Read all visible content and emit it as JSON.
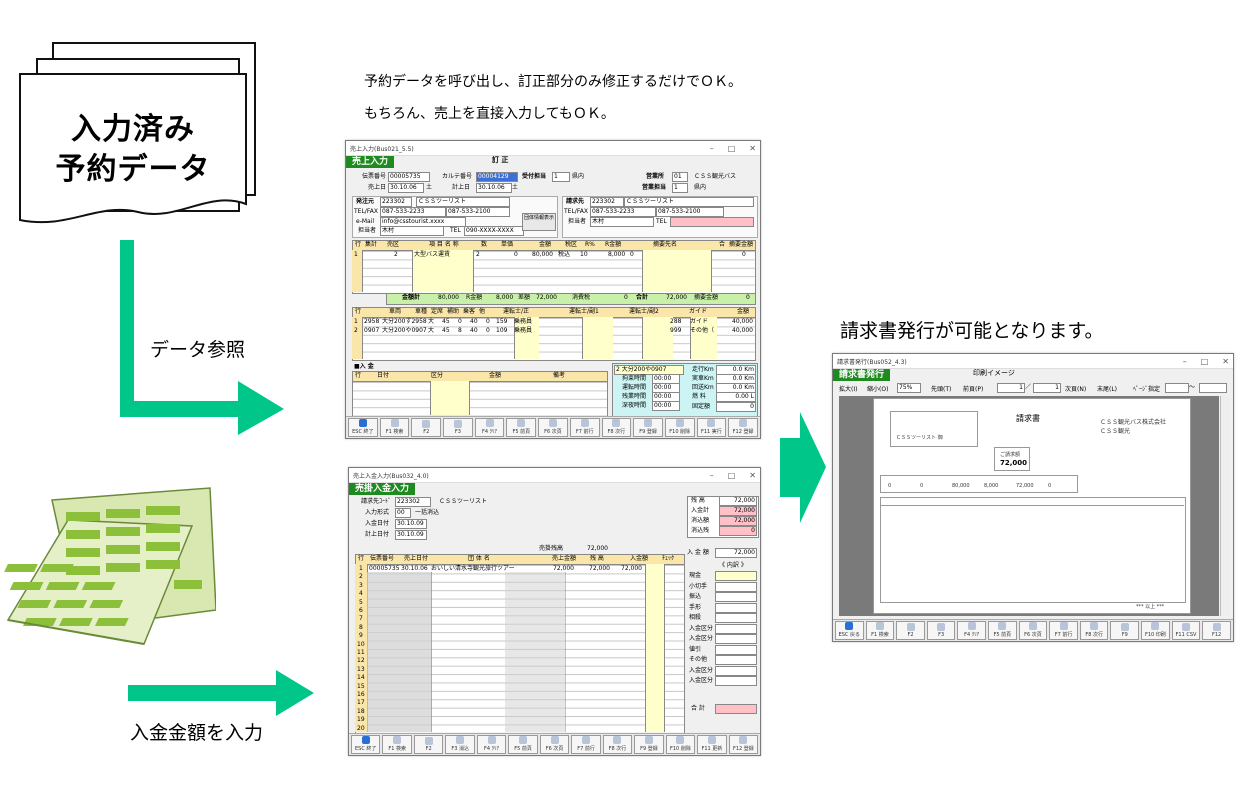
{
  "stack": {
    "line1": "入力済み",
    "line2": "予約データ"
  },
  "captions": {
    "top1": "予約データを呼び出し、訂正部分のみ修正するだけでＯＫ。",
    "top2": "もちろん、売上を直接入力してもＯＫ。",
    "ref": "データ参照",
    "invoice": "請求書発行が可能となります。",
    "payment": "入金金額を入力"
  },
  "colors": {
    "arrow": "#00c689",
    "titlebar": "#1f8a1f",
    "field_yellow": "#ffffcc",
    "field_pink": "#ffc0c8"
  },
  "sales_win": {
    "title": "売上入力(Bus021_5.5)",
    "header": "売上入力",
    "mode": "訂 正",
    "reserve_no_label": "伝票番号",
    "reserve_no": "00005735",
    "karte_label": "カルテ番号",
    "karte": "00004129",
    "charge_label": "受付担当",
    "charge": "1",
    "sales_date_label": "売上日",
    "sales_date": "30.10.06",
    "sales_dow": "土",
    "calc_date_label": "計上日",
    "calc_date": "30.10.06",
    "calc_dow": "土",
    "office_label": "営業所",
    "office": "01",
    "office_name": "ＣＳＳ観光バス",
    "sales_charge_label": "営業担当",
    "sales_charge": "1",
    "sales_charge_area": "県内",
    "orderer_label": "発注元",
    "orderer_code": "223302",
    "orderer_name": "ＣＳＳツーリスト",
    "tel_fax_label": "TEL/FAX",
    "tel": "087-533-2233",
    "fax": "087-533-2100",
    "email_label": "e-Mail",
    "email": "info@csstourist.xxxx",
    "person_label": "担当者",
    "person": "木村",
    "person_tel_label": "TEL",
    "person_tel": "090-XXXX-XXXX",
    "group_btn": "団体情報表示",
    "billto_label": "請求先",
    "billto_code": "223302",
    "billto_name": "ＣＳＳツーリスト",
    "billto_tel": "087-533-2233",
    "billto_fax": "087-533-2100",
    "billto_person": "木村",
    "cols1": [
      "行",
      "集計",
      "売区",
      "項 目 名 称",
      "数",
      "単価",
      "金額",
      "税区",
      "R%",
      "R金額",
      "摘要先名",
      "合",
      "摘要金額"
    ],
    "row1": {
      "no": "1",
      "item_code": "2",
      "item": "大型バス運賃",
      "qty": "2",
      "price": "0",
      "amount": "80,000",
      "tax": "税込",
      "r_pct": "10",
      "r_amount": "8,000",
      "mark": "0",
      "end_amount": "0"
    },
    "sum_labels": {
      "total": "金額計",
      "r_total": "R金額",
      "diff": "差額",
      "tax": "消費税",
      "grand": "合計",
      "memo": "摘要金額"
    },
    "sum_values": {
      "total": "80,000",
      "r_total": "8,000",
      "diff": "72,000",
      "tax": "0",
      "grand": "72,000",
      "memo": "0"
    },
    "cols2": [
      "行",
      "車両",
      "車種",
      "定席",
      "補助",
      "乗客",
      "他",
      "運転士/正",
      "運転士/副1",
      "運転士/副2",
      "ガイド",
      "金額"
    ],
    "vehicles": [
      {
        "no": "1",
        "code": "2958",
        "name": "大分200す2958",
        "type": "大",
        "seat": "45",
        "sub": "0",
        "pass": "40",
        "x": "0",
        "drv_code": "159",
        "drv": "乗務員",
        "guide_code": "288",
        "guide": "ガイド",
        "amount": "40,000"
      },
      {
        "no": "2",
        "code": "0907",
        "name": "大分200や0907",
        "type": "大",
        "seat": "45",
        "sub": "8",
        "pass": "40",
        "x": "0",
        "drv_code": "109",
        "drv": "乗務員",
        "guide_code": "999",
        "guide": "その他（",
        "amount": "40,000"
      }
    ],
    "payment_title": "■入 金",
    "cols3": [
      "行",
      "日付",
      "区分",
      "金額",
      "備考"
    ],
    "vehicle_box": "2  大分200や0907",
    "side_labels": [
      "拘束時間",
      "運転時間",
      "残業時間",
      "深夜時間"
    ],
    "side_values": [
      "00:00",
      "00:00",
      "00:00",
      "00:00"
    ],
    "dist_labels": [
      "走行Km",
      "実車Km",
      "回送Km",
      "燃 料",
      "固定額"
    ],
    "dist_values": [
      "0.0 Km",
      "0.0 Km",
      "0.0 Km",
      "0.00 L",
      "0"
    ]
  },
  "invoice_win": {
    "title": "請求書発行(Bus052_4.3)",
    "header": "請求書発行",
    "subtitle": "印刷イメージ",
    "zoom_in": "拡大(I)",
    "zoom_out": "縮小(O)",
    "zoom": "75%",
    "first": "先頭(T)",
    "prev": "前頁(P)",
    "page": "1",
    "page_total": "1",
    "next": "次頁(N)",
    "last": "末尾(L)",
    "page_spec": "ﾍﾟｰｼﾞ指定",
    "doc_title": "請求書",
    "customer": "ＣＳＳツーリスト 御",
    "company1": "ＣＳＳ観光バス株式会社",
    "company2": "ＣＳＳ観光",
    "amount_label": "ご請求額",
    "amount": "72,000",
    "row_values": [
      "0",
      "0",
      "80,000",
      "8,000",
      "72,000",
      "0"
    ],
    "footer_note": "*** 以上 ***"
  },
  "payment_win": {
    "title": "売上入金入力(Bus032_4.0)",
    "header": "売掛入金入力",
    "billto_label": "請求先ｺｰﾄﾞ",
    "billto_code": "223302",
    "billto_name": "ＣＳＳツーリスト",
    "input_mode_label": "入力形式",
    "input_mode": "一括消込",
    "pay_date_label": "入金日付",
    "pay_date": "30.10.09",
    "calc_date_label": "計上日付",
    "calc_date": "30.10.09",
    "sales_total_label": "売掛残高",
    "sales_total": "72,000",
    "cols": [
      "行",
      "伝票番号",
      "売上日付",
      "団 体 名",
      "売上金額",
      "残 高",
      "入金額",
      "ﾁｪｯｸ"
    ],
    "row1": {
      "no": "1",
      "slip": "00005735",
      "date": "30.10.06",
      "group": "おいしい清水寺観光旅行ツアー",
      "amount": "72,000",
      "balance": "72,000",
      "paid": "72,000"
    },
    "summary_labels": [
      "残 高",
      "入金計",
      "消込額",
      "消込残"
    ],
    "summary_values": [
      "72,000",
      "72,000",
      "72,000",
      "0"
    ],
    "pay_amount_label": "入 金 額",
    "pay_amount": "72,000",
    "breakdown_title": "《 内訳 》",
    "breakdown_labels": [
      "現金",
      "小切手",
      "振込",
      "手形",
      "相殺",
      "入金区分",
      "入金区分",
      "値引",
      "その他",
      "入金区分",
      "入金区分"
    ],
    "total_label": "合 計"
  },
  "toolbar_sales": [
    "ESC 終了",
    "F1 検索",
    "F2",
    "F3",
    "F4 ｸﾘｱ",
    "F5 前頁",
    "F6 次頁",
    "F7 前行",
    "F8 次行",
    "F9 登録",
    "F10 削除",
    "F11 実行",
    "F12 登録"
  ],
  "toolbar_payment": [
    "ESC 終了",
    "F1 検索",
    "F2",
    "F3 消込",
    "F4 ｸﾘｱ",
    "F5 前頁",
    "F6 次頁",
    "F7 前行",
    "F8 次行",
    "F9 登録",
    "F10 削除",
    "F11 更新",
    "F12 登録"
  ],
  "toolbar_invoice": [
    "ESC 戻る",
    "F1 検索",
    "F2",
    "F3",
    "F4 ｸﾘｱ",
    "F5 前頁",
    "F6 次頁",
    "F7 前行",
    "F8 次行",
    "F9",
    "F10 印刷",
    "F11 CSV",
    "F12"
  ]
}
